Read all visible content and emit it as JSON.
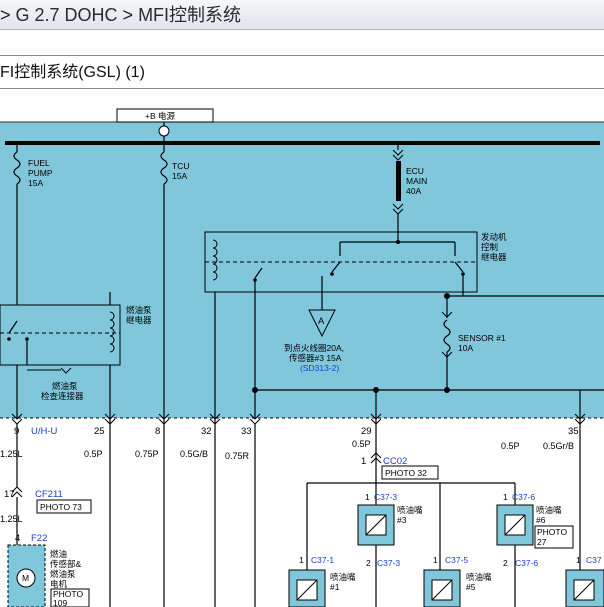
{
  "topbar": {
    "separator": ">",
    "crumbs": [
      "G 2.7 DOHC",
      "MFI控制系统"
    ]
  },
  "title": {
    "text": "FI控制系统(GSL) (1)"
  },
  "supply": {
    "label": "+B 电源"
  },
  "fuses": [
    {
      "lines": [
        "FUEL",
        "PUMP",
        "15A"
      ]
    },
    {
      "lines": [
        "TCU",
        "15A"
      ]
    },
    {
      "lines": [
        "ECU",
        "MAIN",
        "40A"
      ]
    },
    {
      "lines": [
        "SENSOR #1",
        "10A"
      ]
    }
  ],
  "relays": {
    "engine": {
      "lines": [
        "发动机",
        "控制",
        "继电器"
      ]
    },
    "fuel_pump": {
      "lines": [
        "燃油泵",
        "继电器"
      ]
    },
    "check_connector": {
      "lines": [
        "燃油泵",
        "检查连接器"
      ]
    }
  },
  "ignition_ref": {
    "symbol": "A",
    "lines": [
      "到点火线圈20A,",
      "传感器#3 15A"
    ],
    "ref": "(SD313-2)"
  },
  "pins": [
    {
      "num": "9",
      "code": "U/H-U"
    },
    {
      "num": "25"
    },
    {
      "num": "8"
    },
    {
      "num": "32"
    },
    {
      "num": "33"
    },
    {
      "num": "29"
    },
    {
      "num": "35"
    }
  ],
  "wires": [
    "1.25L",
    "0.5P",
    "0.75P",
    "0.5G/B",
    "0.75R",
    "0.5P",
    "0.5P",
    "0.5Gr/B"
  ],
  "splice": {
    "pin": "1",
    "id": "CC02",
    "photo": "PHOTO 32"
  },
  "left_conn": {
    "pin": "17",
    "id": "CF211",
    "photo": "PHOTO 73",
    "wire": "1.25L",
    "pin2": "4",
    "id2": "F22"
  },
  "motor": {
    "symbol": "M",
    "lines": [
      "燃油",
      "传感部&",
      "燃油泵",
      "电机"
    ],
    "photo": [
      "PHOTO",
      "109"
    ]
  },
  "injectors": [
    {
      "pin_in": "1",
      "id": "C37-3",
      "name": [
        "喷油嘴",
        "#3"
      ],
      "pin_out": "2",
      "id_out": "C37-3"
    },
    {
      "pin_in": "1",
      "id": "C37-6",
      "name": [
        "喷油嘴",
        "#6"
      ],
      "photo": [
        "PHOTO",
        "27"
      ],
      "pin_out": "2",
      "id_out": "C37-6"
    },
    {
      "pin_in": "1",
      "id": "C37-1",
      "name": [
        "喷油嘴",
        "#1"
      ]
    },
    {
      "pin_in": "1",
      "id": "C37-5",
      "name": [
        "喷油嘴",
        "#5"
      ]
    },
    {
      "pin_in": "1",
      "id": "C37"
    }
  ],
  "colors": {
    "panel": "#81c7dc",
    "link_blue": "#1a3fc9",
    "bus": "#000000"
  },
  "icons": [
    "fuse-symbol-icon",
    "connector-chevron-icon",
    "relay-coil-icon",
    "switch-contact-icon",
    "reference-triangle-icon",
    "injector-icon",
    "motor-icon",
    "splice-dot-icon"
  ]
}
